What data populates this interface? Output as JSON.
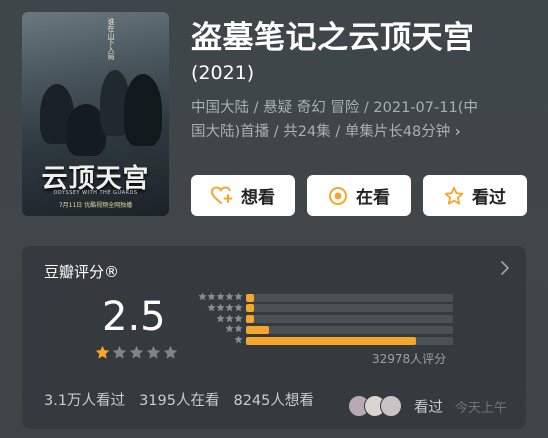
{
  "movie": {
    "poster": {
      "title": "云顶天宫",
      "vertical_text": "谁在山下入局",
      "subtitle": "ODYSSEY WITH THE GUARDS",
      "date": "7月11日 优酷视频全网独播"
    },
    "title": "盗墓笔记之云顶天宫",
    "year": "(2021)",
    "info": "中国大陆 / 悬疑 奇幻 冒险 / 2021-07-11(中国大陆)首播 / 共24集 / 单集片长48分钟",
    "info_chevron": "›"
  },
  "actions": [
    {
      "label": "想看",
      "icon": "heart-plus-icon"
    },
    {
      "label": "在看",
      "icon": "target-icon"
    },
    {
      "label": "看过",
      "icon": "star-outline-icon"
    }
  ],
  "rating": {
    "title": "豆瓣评分®",
    "score": "2.5",
    "score_stars": 1,
    "distribution": [
      {
        "stars": 5,
        "percent": 4
      },
      {
        "stars": 4,
        "percent": 4
      },
      {
        "stars": 3,
        "percent": 4
      },
      {
        "stars": 2,
        "percent": 11
      },
      {
        "stars": 1,
        "percent": 82
      }
    ],
    "count_label": "32978人评分",
    "accent_color": "#f7a62c"
  },
  "stats": {
    "watched": "3.1万人看过",
    "watching": "3195人在看",
    "want": "8245人想看"
  },
  "friends": {
    "label": "看过",
    "time": "今天上午"
  }
}
